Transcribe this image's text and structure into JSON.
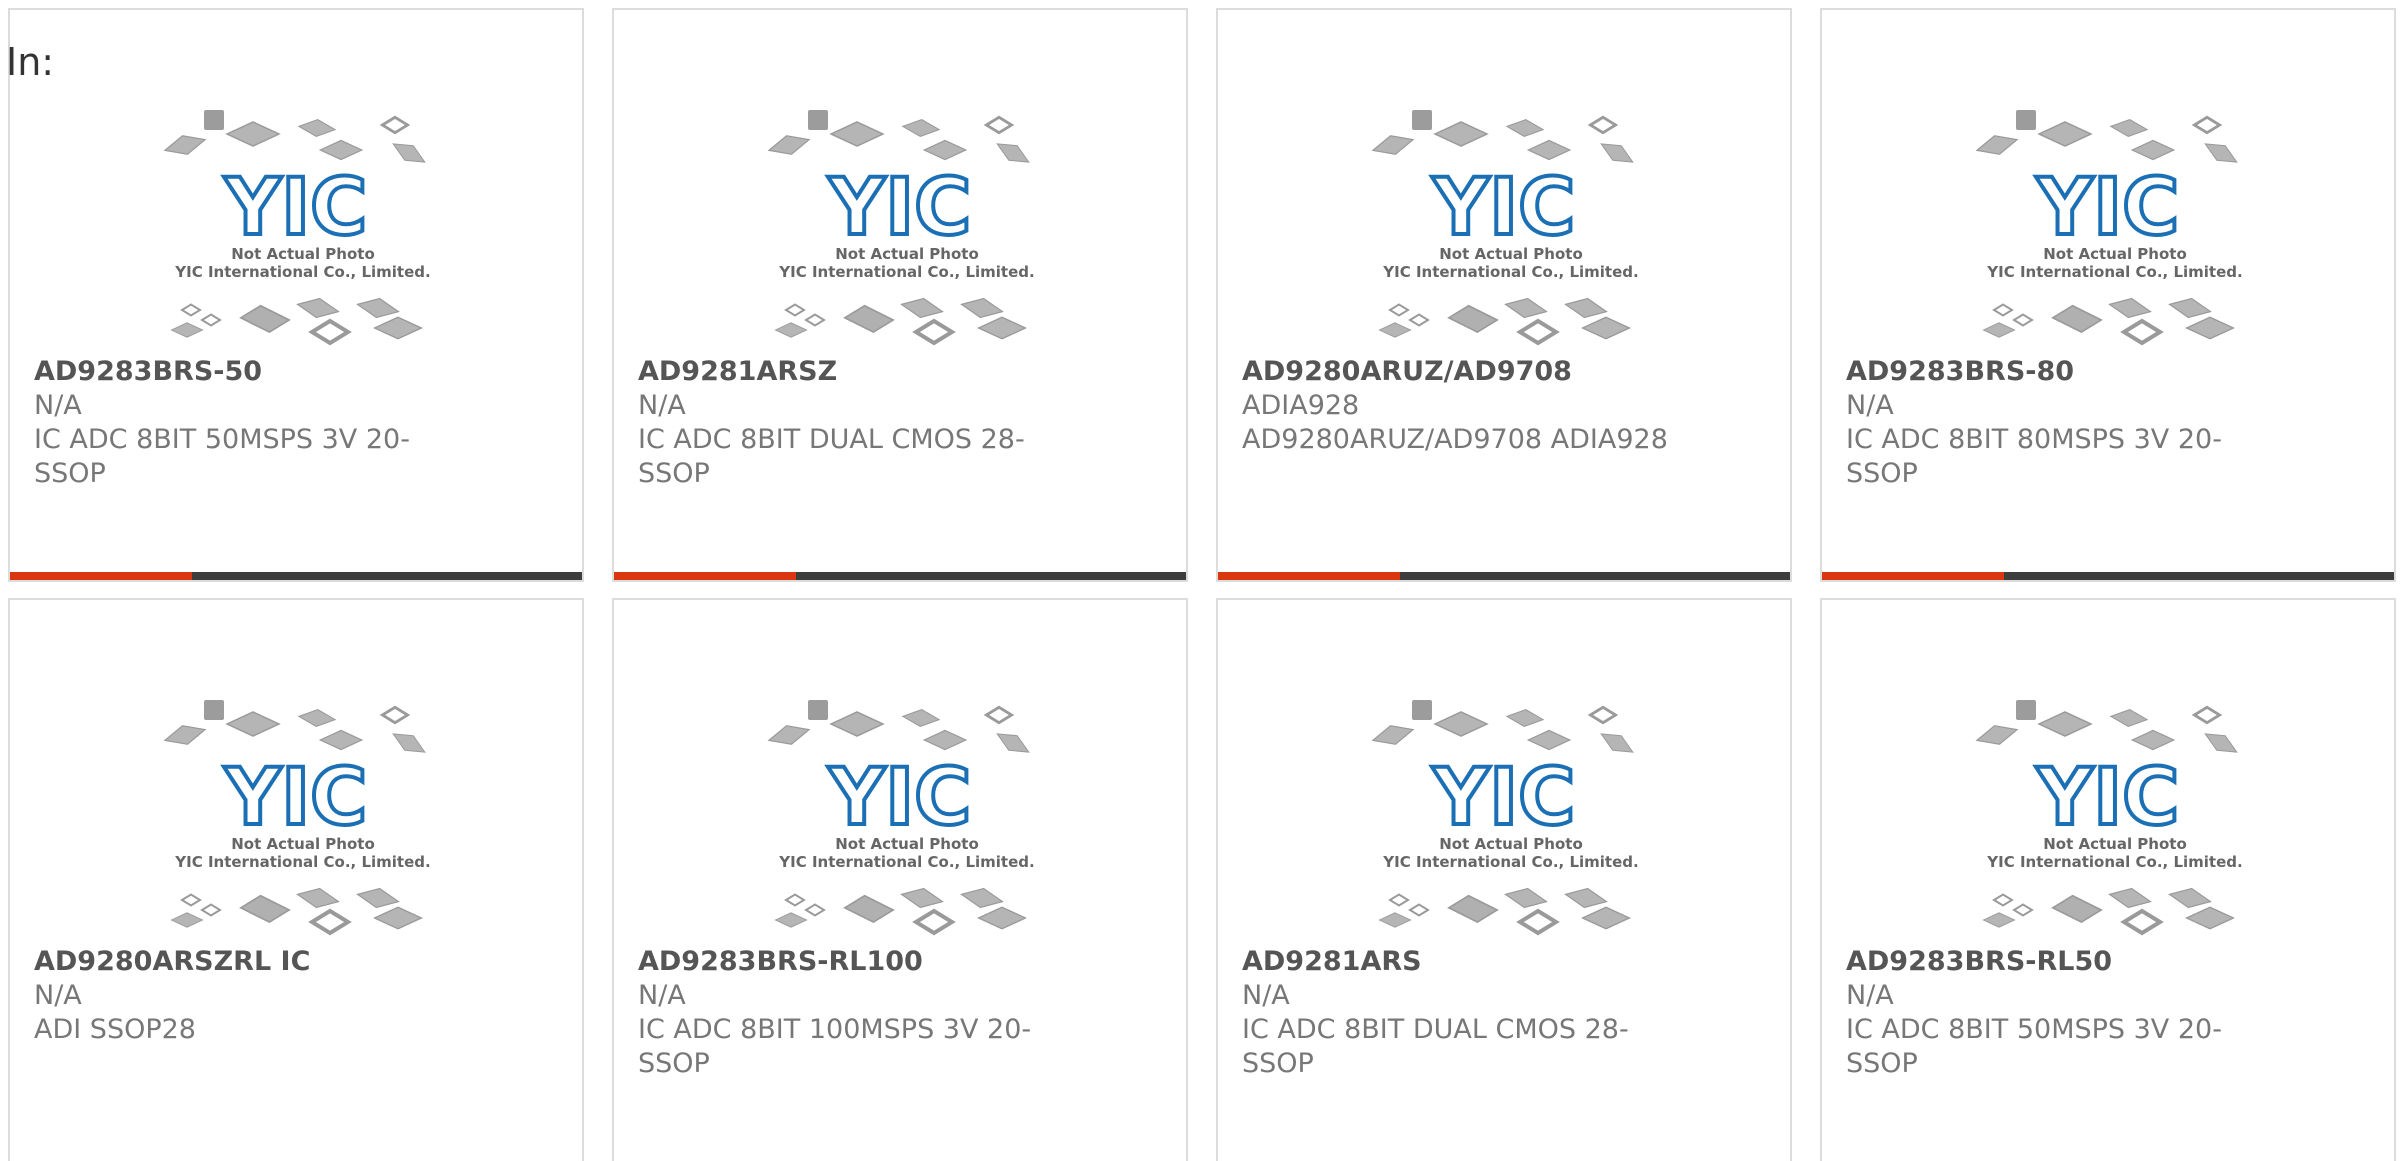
{
  "header": {
    "label": "In:"
  },
  "placeholder_image": {
    "caption_line1": "Not Actual Photo",
    "caption_line2": "YIC International Co., Limited.",
    "logo_text": "YIC",
    "icon": "chip-packages-placeholder"
  },
  "colors": {
    "accent": "#d9380e",
    "bar_dark": "#3d3d3d",
    "logo_blue": "#1a6fb5",
    "chip_gray": "#b9b9b9"
  },
  "products": [
    {
      "part": "AD9283BRS-50",
      "manufacturer": "N/A",
      "description": [
        "IC ADC 8BIT 50MSPS 3V 20-SSOP"
      ]
    },
    {
      "part": "AD9281ARSZ",
      "manufacturer": "N/A",
      "description": [
        "IC ADC 8BIT DUAL CMOS 28-",
        "SSOP"
      ]
    },
    {
      "part": "AD9280ARUZ/AD9708",
      "manufacturer": "ADIA928",
      "description": [
        "AD9280ARUZ/AD9708 ADIA928"
      ]
    },
    {
      "part": "AD9283BRS-80",
      "manufacturer": "N/A",
      "description": [
        "IC ADC 8BIT 80MSPS 3V 20-SSOP"
      ]
    },
    {
      "part": "AD9280ARSZRL IC",
      "manufacturer": "N/A",
      "description": [
        "ADI SSOP28"
      ]
    },
    {
      "part": "AD9283BRS-RL100",
      "manufacturer": "N/A",
      "description": [
        "IC ADC 8BIT 100MSPS 3V 20-",
        "SSOP"
      ]
    },
    {
      "part": "AD9281ARS",
      "manufacturer": "N/A",
      "description": [
        "IC ADC 8BIT DUAL CMOS 28-",
        "SSOP"
      ]
    },
    {
      "part": "AD9283BRS-RL50",
      "manufacturer": "N/A",
      "description": [
        "IC ADC 8BIT 50MSPS 3V 20-SSOP"
      ]
    }
  ]
}
